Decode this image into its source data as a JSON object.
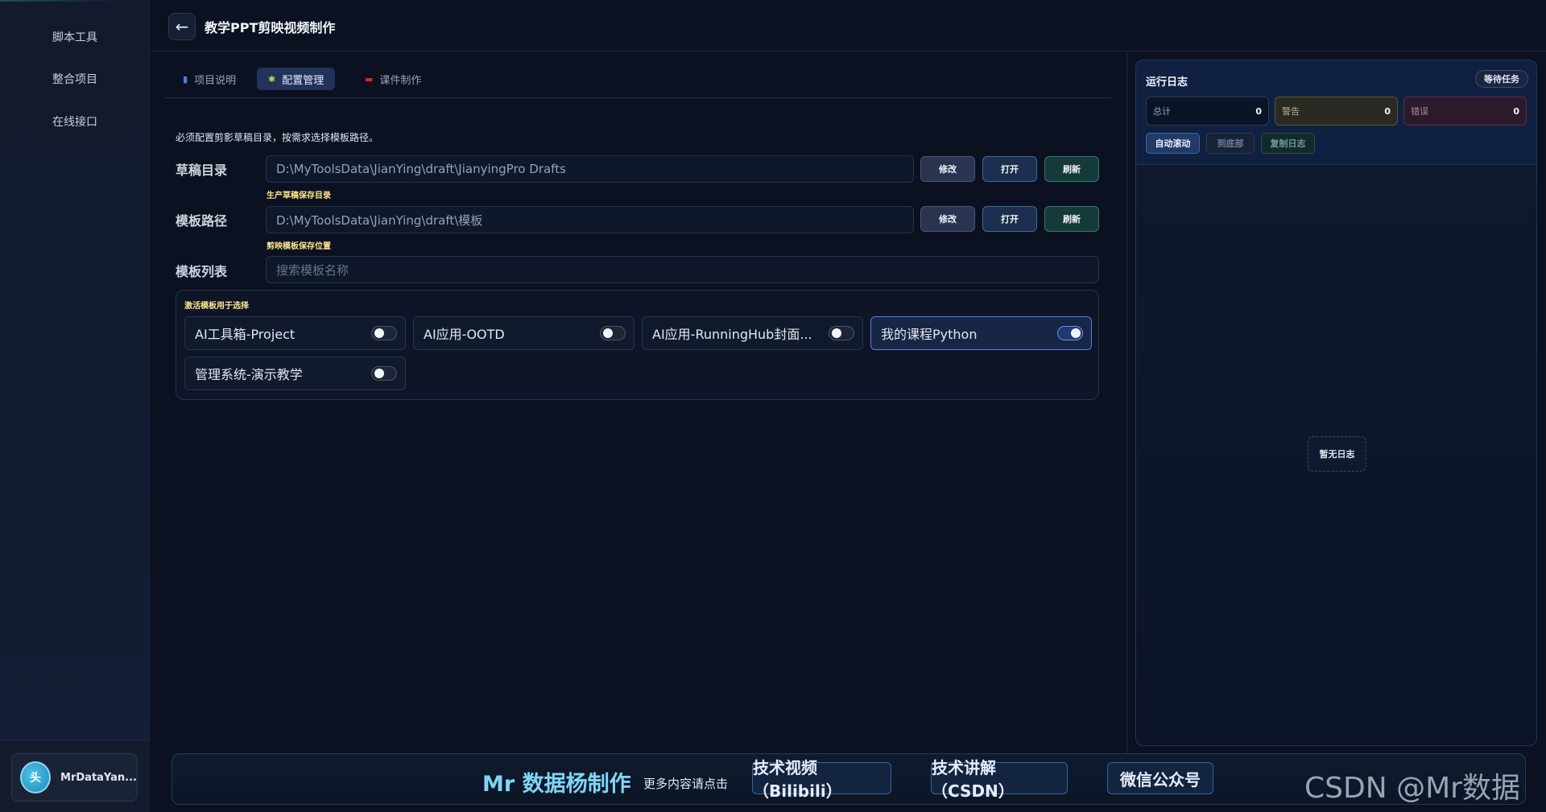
{
  "sidebar": {
    "items": [
      {
        "label": "脚本工具"
      },
      {
        "label": "整合项目"
      },
      {
        "label": "在线接口"
      }
    ],
    "user": {
      "avatar_text": "头",
      "name": "MrDataYan..."
    }
  },
  "header": {
    "back_icon": "←",
    "title": "教学PPT剪映视频制作"
  },
  "tabs": [
    {
      "label": "项目说明",
      "icon": "book-icon"
    },
    {
      "label": "配置管理",
      "icon": "puzzle-icon",
      "active": true
    },
    {
      "label": "课件制作",
      "icon": "slides-icon"
    }
  ],
  "config": {
    "hint": "必须配置剪影草稿目录，按需求选择模板路径。",
    "draft": {
      "label": "草稿目录",
      "value": "D:\\MyToolsData\\JianYing\\draft\\JianyingPro Drafts",
      "sub_hint": "生产草稿保存目录"
    },
    "template": {
      "label": "模板路径",
      "value": "D:\\MyToolsData\\JianYing\\draft\\模板",
      "sub_hint": "剪映模板保存位置"
    },
    "buttons": {
      "edit": "修改",
      "open": "打开",
      "refresh": "刷新"
    },
    "list": {
      "label": "模板列表",
      "search_placeholder": "搜索模板名称",
      "box_title": "激活模板用于选择",
      "items": [
        {
          "name": "AI工具箱-Project",
          "active": false
        },
        {
          "name": "AI应用-OOTD",
          "active": false
        },
        {
          "name": "AI应用-RunningHub封面...",
          "active": false
        },
        {
          "name": "我的课程Python",
          "active": true
        },
        {
          "name": "管理系统-演示教学",
          "active": false
        }
      ]
    }
  },
  "log": {
    "title": "运行日志",
    "status_badge": "等待任务",
    "stats": {
      "total_label": "总计",
      "total_value": "0",
      "warn_label": "警告",
      "warn_value": "0",
      "error_label": "错误",
      "error_value": "0"
    },
    "buttons": {
      "auto_scroll": "自动滚动",
      "to_bottom": "到底部",
      "copy": "复制日志"
    },
    "empty": "暂无日志"
  },
  "footer": {
    "brand": "Mr 数据杨制作",
    "sub": "更多内容请点击",
    "links": [
      "技术视频（Bilibili）",
      "技术讲解（CSDN）",
      "微信公众号"
    ]
  },
  "watermark": "CSDN @Mr数据杨",
  "colors": {
    "background": "#0b1120",
    "accent": "#7fd6f2",
    "active_tab": "#23325a",
    "hint_yellow": "#fde68a"
  }
}
